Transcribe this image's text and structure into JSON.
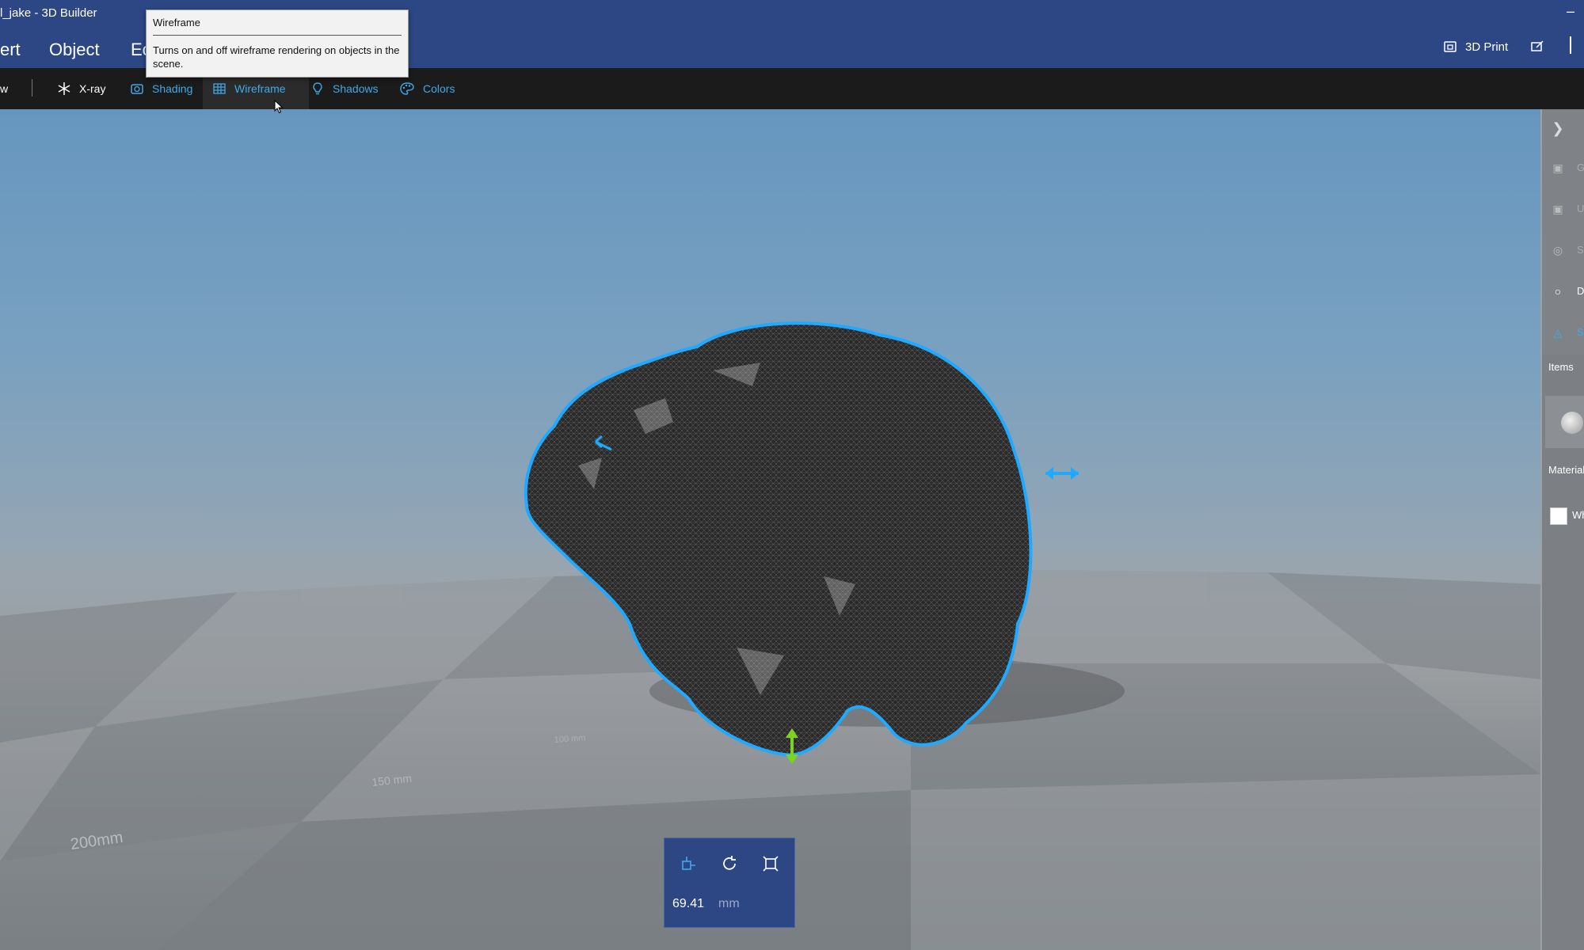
{
  "window": {
    "title": "l_jake - 3D Builder",
    "minimize_glyph": "–"
  },
  "ribbon": {
    "menus": [
      "ert",
      "Object",
      "Ec"
    ],
    "print_label": "3D Print",
    "print_icon": "printer-icon",
    "extra_icon": "share-icon"
  },
  "toolbar": {
    "first_label": "w",
    "items": [
      {
        "label": "X-ray",
        "icon": "asterisk-icon"
      },
      {
        "label": "Shading",
        "icon": "shading-icon"
      },
      {
        "label": "Wireframe",
        "icon": "grid-icon",
        "selected": true
      },
      {
        "label": "Shadows",
        "icon": "lightbulb-icon"
      },
      {
        "label": "Colors",
        "icon": "palette-icon"
      }
    ]
  },
  "tooltip": {
    "title": "Wireframe",
    "description": "Turns on and off wireframe rendering on objects in the scene."
  },
  "right_panel": {
    "labels": [
      "G",
      "U",
      "S",
      "D",
      "S"
    ],
    "items_label": "Items",
    "material_label": "Material",
    "material_value": "Wh"
  },
  "scene": {
    "floor_labels": [
      "200mm",
      "150 mm",
      "100 mm"
    ]
  },
  "dimension": {
    "value": "69.41",
    "unit": "mm"
  },
  "colors": {
    "accent": "#2c4783",
    "toolbar_bg": "#1b1b1b",
    "toolbar_blue": "#3fa9e8",
    "selection_outline": "#1fa9ff",
    "axis_green": "#7ed321"
  }
}
